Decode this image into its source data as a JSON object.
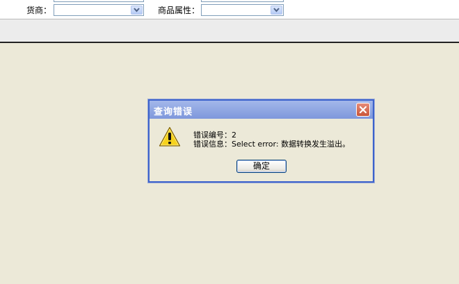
{
  "filters": {
    "supplier_label": "货商：",
    "supplier_value": "",
    "attribute_label": "商品属性：",
    "attribute_value": ""
  },
  "dialog": {
    "title": "查询错误",
    "error_code_label": "错误编号：",
    "error_code_value": "2",
    "error_info_label": "错误信息：",
    "error_info_value": "Select error: 数据转换发生溢出。",
    "ok_label": "确定",
    "icon": "warning-icon",
    "title_bar_color": "#8fa6e2",
    "border_color": "#3d63cc"
  },
  "colors": {
    "background": "#ece9d8",
    "close_button": "#c95538"
  }
}
